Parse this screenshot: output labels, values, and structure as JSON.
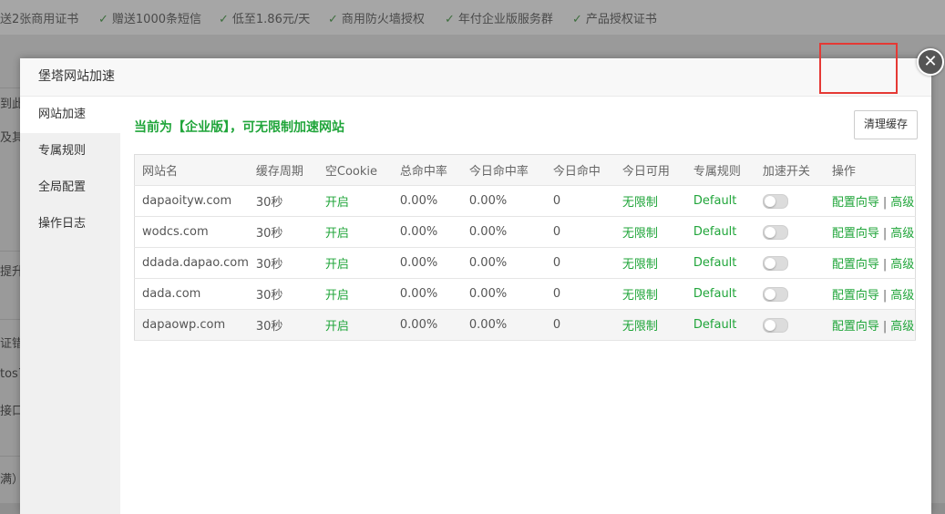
{
  "promo": {
    "items": [
      {
        "text": "送2张商用证书",
        "has_check": false
      },
      {
        "text": "赠送1000条短信",
        "has_check": true
      },
      {
        "text": "低至1.86元/天",
        "has_check": true
      },
      {
        "text": "商用防火墙授权",
        "has_check": true
      },
      {
        "text": "年付企业版服务群",
        "has_check": true
      },
      {
        "text": "产品授权证书",
        "has_check": true
      }
    ]
  },
  "background_fragments": [
    "到此",
    "及其",
    "提升",
    "证错",
    "tos7",
    "接口,",
    "满）"
  ],
  "dialog": {
    "title": "堡塔网站加速",
    "close_symbol": "✕"
  },
  "sidebar": {
    "items": [
      {
        "label": "网站加速",
        "active": true
      },
      {
        "label": "专属规则",
        "active": false
      },
      {
        "label": "全局配置",
        "active": false
      },
      {
        "label": "操作日志",
        "active": false
      }
    ]
  },
  "main": {
    "notice": "当前为【企业版】，可无限制加速网站",
    "clear_cache_label": "清理缓存"
  },
  "table": {
    "headers": [
      "网站名",
      "缓存周期",
      "空Cookie",
      "总命中率",
      "今日命中率",
      "今日命中",
      "今日可用",
      "专属规则",
      "加速开关",
      "操作"
    ],
    "rows": [
      {
        "site": "dapaoityw.com",
        "cache": "30秒",
        "cookie": "开启",
        "total_hit": "0.00%",
        "today_rate": "0.00%",
        "today_hit": "0",
        "today_avail": "无限制",
        "rule": "Default",
        "switch_on": false,
        "op_config": "配置向导",
        "op_advanced": "高级"
      },
      {
        "site": "wodcs.com",
        "cache": "30秒",
        "cookie": "开启",
        "total_hit": "0.00%",
        "today_rate": "0.00%",
        "today_hit": "0",
        "today_avail": "无限制",
        "rule": "Default",
        "switch_on": false,
        "op_config": "配置向导",
        "op_advanced": "高级"
      },
      {
        "site": "ddada.dapao.com",
        "cache": "30秒",
        "cookie": "开启",
        "total_hit": "0.00%",
        "today_rate": "0.00%",
        "today_hit": "0",
        "today_avail": "无限制",
        "rule": "Default",
        "switch_on": false,
        "op_config": "配置向导",
        "op_advanced": "高级"
      },
      {
        "site": "dada.com",
        "cache": "30秒",
        "cookie": "开启",
        "total_hit": "0.00%",
        "today_rate": "0.00%",
        "today_hit": "0",
        "today_avail": "无限制",
        "rule": "Default",
        "switch_on": false,
        "op_config": "配置向导",
        "op_advanced": "高级"
      },
      {
        "site": "dapaowp.com",
        "cache": "30秒",
        "cookie": "开启",
        "total_hit": "0.00%",
        "today_rate": "0.00%",
        "today_hit": "0",
        "today_avail": "无限制",
        "rule": "Default",
        "switch_on": false,
        "op_config": "配置向导",
        "op_advanced": "高级"
      }
    ]
  },
  "colors": {
    "accent_green": "#20a53a",
    "highlight_red": "#e53935"
  }
}
